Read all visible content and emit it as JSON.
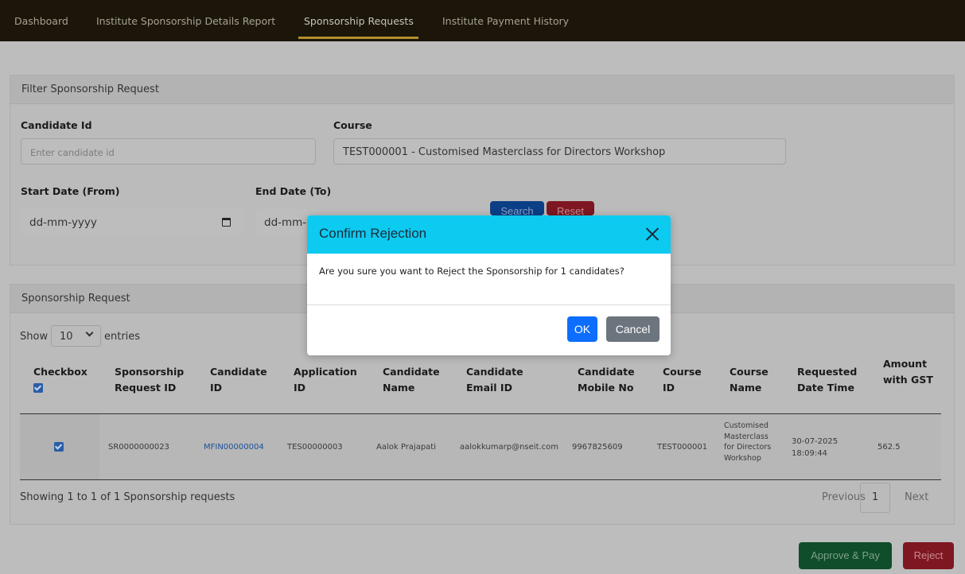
{
  "nav": {
    "items": [
      "Dashboard",
      "Institute Sponsorship Details Report",
      "Sponsorship Requests",
      "Institute Payment History"
    ],
    "active": "Sponsorship Requests"
  },
  "filter": {
    "title": "Filter Sponsorship Request",
    "candidate_id_label": "Candidate Id",
    "candidate_id_placeholder": "Enter candidate id",
    "course_label": "Course",
    "course_value": "TEST000001 - Customised Masterclass for Directors Workshop",
    "start_label": "Start Date (From)",
    "start_value": "dd-mm-yyyy",
    "end_label": "End Date (To)",
    "end_value": "dd-mm-",
    "search_label": "Search",
    "reset_label": "Reset"
  },
  "requests": {
    "title": "Sponsorship Request",
    "show_label": "Show",
    "entries_value": "10",
    "entries_label": "entries",
    "columns": [
      "Checkbox",
      "Sponsorship Request ID",
      "Candidate ID",
      "Application ID",
      "Candidate Name",
      "Candidate Email ID",
      "Candidate Mobile No",
      "Course ID",
      "Course Name",
      "Requested Date Time",
      "Amount with GST"
    ],
    "rows": [
      {
        "checked": true,
        "request_id": "SR0000000023",
        "candidate_id": "MFIN00000004",
        "application_id": "TES00000003",
        "name": "Aalok Prajapati",
        "email": "aalokkumarp@nseit.com",
        "mobile": "9967825609",
        "course_id": "TEST000001",
        "course_name": "Customised Masterclass for Directors Workshop",
        "requested": "30-07-2025 18:09:44",
        "amount": "562.5"
      }
    ],
    "summary": "Showing 1 to 1 of 1 Sponsorship requests",
    "previous": "Previous",
    "page": "1",
    "next": "Next"
  },
  "actions": {
    "approve": "Approve & Pay",
    "reject": "Reject"
  },
  "modal": {
    "title": "Confirm Rejection",
    "message": "Are you sure you want to Reject the Sponsorship for 1 candidates?",
    "ok": "OK",
    "cancel": "Cancel"
  },
  "colors": {
    "modal_header": "#0dcaf0",
    "ok": "#0d6efd",
    "cancel": "#6c757d",
    "nav_bg": "#1b1609",
    "nav_accent": "#b38f2c"
  }
}
